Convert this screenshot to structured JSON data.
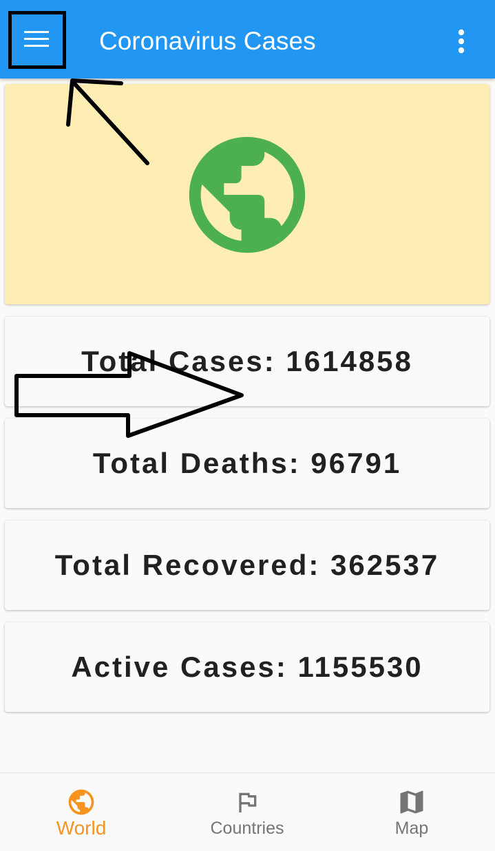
{
  "app_bar": {
    "title": "Coronavirus Cases",
    "menu_icon": "menu-icon",
    "more_icon": "more-vert-icon",
    "color": "#2196f3"
  },
  "hero": {
    "icon": "globe-icon",
    "background": "#ffeeb3",
    "icon_color": "#4caf50"
  },
  "stats": [
    {
      "label": "Total Cases: 1614858"
    },
    {
      "label": "Total Deaths: 96791"
    },
    {
      "label": "Total Recovered: 362537"
    },
    {
      "label": "Active Cases: 1155530"
    }
  ],
  "bottom_nav": {
    "items": [
      {
        "label": "World",
        "icon": "globe-icon",
        "active": true
      },
      {
        "label": "Countries",
        "icon": "flag-icon",
        "active": false
      },
      {
        "label": "Map",
        "icon": "map-icon",
        "active": false
      }
    ],
    "active_color": "#f7931e",
    "inactive_color": "#757575"
  },
  "annotations": {
    "up_arrow": "arrow-pointing-to-menu",
    "right_arrow": "block-arrow-pointing-right",
    "color": "#000000"
  }
}
